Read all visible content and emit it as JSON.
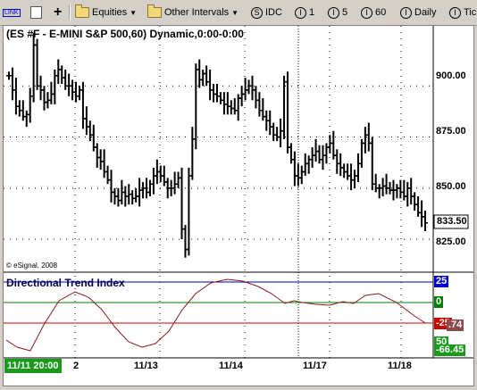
{
  "toolbar": {
    "link_label": "LINK",
    "equities_label": "Equities",
    "intervals_label": "Other Intervals",
    "symbol_type": "IDC",
    "interval_1": "1",
    "interval_5": "5",
    "interval_60": "60",
    "interval_daily": "Daily",
    "interval_tick": "Tic"
  },
  "chart": {
    "title": "(ES #F - E-MINI S&P 500,60) Dynamic,0:00-0:00",
    "copyright": "© eSignal, 2008",
    "last_price": "833.50",
    "price_axis": [
      "900.00",
      "875.00",
      "850.00",
      "825.00"
    ],
    "dates": [
      "11/13",
      "11/14",
      "11/17",
      "11/18"
    ],
    "cursor_date": "11/11 20:00",
    "cursor_date_tail": "2"
  },
  "indicator": {
    "title": "Directional Trend Index",
    "level_upper": "25",
    "level_zero": "0",
    "level_lower": "-25",
    "current_value_tail": ".74",
    "level_bottom": "50",
    "bottom_value": "-66.45"
  },
  "chart_data": {
    "type": "bar",
    "title": "(ES #F - E-MINI S&P 500,60) Dynamic,0:00-0:00",
    "y_range": [
      815,
      925
    ],
    "y_ticks": [
      900,
      875,
      850,
      825
    ],
    "last": 833.5,
    "x_labels": [
      "11/13",
      "11/14",
      "11/17",
      "11/18"
    ],
    "close": [
      905,
      898,
      890,
      888,
      885,
      886,
      895,
      920,
      900,
      898,
      892,
      893,
      896,
      905,
      908,
      904,
      900,
      900,
      897,
      895,
      898,
      884,
      880,
      876,
      870,
      865,
      863,
      858,
      854,
      848,
      846,
      844,
      848,
      846,
      847,
      845,
      846,
      849,
      850,
      848,
      852,
      856,
      858,
      856,
      853,
      850,
      850,
      852,
      855,
      830,
      820,
      856,
      874,
      908,
      903,
      906,
      902,
      898,
      896,
      895,
      893,
      891,
      890,
      889,
      888,
      894,
      896,
      898,
      900,
      898,
      893,
      888,
      885,
      883,
      880,
      876,
      875,
      878,
      902,
      870,
      864,
      856,
      855,
      858,
      862,
      864,
      866,
      868,
      864,
      866,
      870,
      872,
      866,
      862,
      860,
      858,
      856,
      854,
      856,
      862,
      872,
      876,
      872,
      852,
      850,
      850,
      851,
      850,
      849,
      849,
      850,
      848,
      846,
      850,
      846,
      842,
      838,
      836,
      833
    ],
    "dti": {
      "type": "line",
      "levels": [
        25,
        0,
        -25
      ],
      "last": -66.45
    }
  }
}
